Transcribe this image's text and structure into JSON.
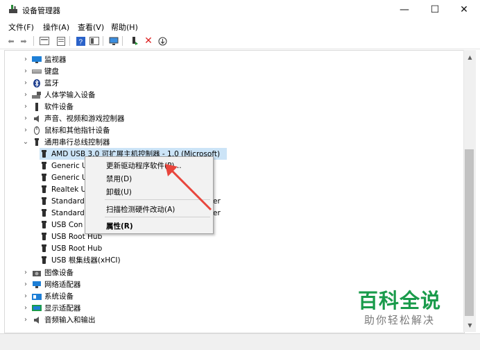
{
  "window": {
    "title": "设备管理器",
    "minimize": "—",
    "maximize": "☐",
    "close": "✕"
  },
  "menu": [
    "文件(F)",
    "操作(A)",
    "查看(V)",
    "帮助(H)"
  ],
  "tree": {
    "items": [
      {
        "label": "监视器",
        "icon": "monitor-icon",
        "color": "#1e7fd6"
      },
      {
        "label": "键盘",
        "icon": "keyboard-icon",
        "color": "#6e6e6e"
      },
      {
        "label": "蓝牙",
        "icon": "bluetooth-icon",
        "color": "#1f5fbf"
      },
      {
        "label": "人体学输入设备",
        "icon": "hid-icon",
        "color": "#555555"
      },
      {
        "label": "软件设备",
        "icon": "software-device-icon",
        "color": "#333333"
      },
      {
        "label": "声音、视频和游戏控制器",
        "icon": "speaker-icon",
        "color": "#555555"
      },
      {
        "label": "鼠标和其他指针设备",
        "icon": "mouse-icon",
        "color": "#555555"
      },
      {
        "label": "通用串行总线控制器",
        "icon": "usb-icon",
        "color": "#333333"
      }
    ],
    "usb_children": [
      "AMD USB 3.0 可扩展主机控制器 - 1.0 (Microsoft)",
      "Generic U",
      "Generic U",
      "Realtek U",
      "Standard",
      "Standard",
      "USB Con",
      "USB Root Hub",
      "USB Root Hub",
      "USB 根集线器(xHCI)"
    ],
    "usb_child_suffix": [
      "er",
      "er"
    ],
    "items_after": [
      {
        "label": "图像设备",
        "icon": "camera-icon",
        "color": "#555555"
      },
      {
        "label": "网络适配器",
        "icon": "network-icon",
        "color": "#1e7fd6"
      },
      {
        "label": "系统设备",
        "icon": "system-icon",
        "color": "#1e7fd6"
      },
      {
        "label": "显示适配器",
        "icon": "display-adapter-icon",
        "color": "#1a9b4b"
      },
      {
        "label": "音频输入和输出",
        "icon": "audio-icon",
        "color": "#555555"
      }
    ]
  },
  "context_menu": {
    "update_driver": "更新驱动程序软件(P)...",
    "disable": "禁用(D)",
    "uninstall": "卸载(U)",
    "scan": "扫描检测硬件改动(A)",
    "properties": "属性(R)"
  },
  "watermark": {
    "title": "百科全说",
    "subtitle": "助你轻松解决",
    "color": "#1a9b4b"
  },
  "accent": {
    "selection": "#cce4f7",
    "arrow": "#e8453c"
  }
}
